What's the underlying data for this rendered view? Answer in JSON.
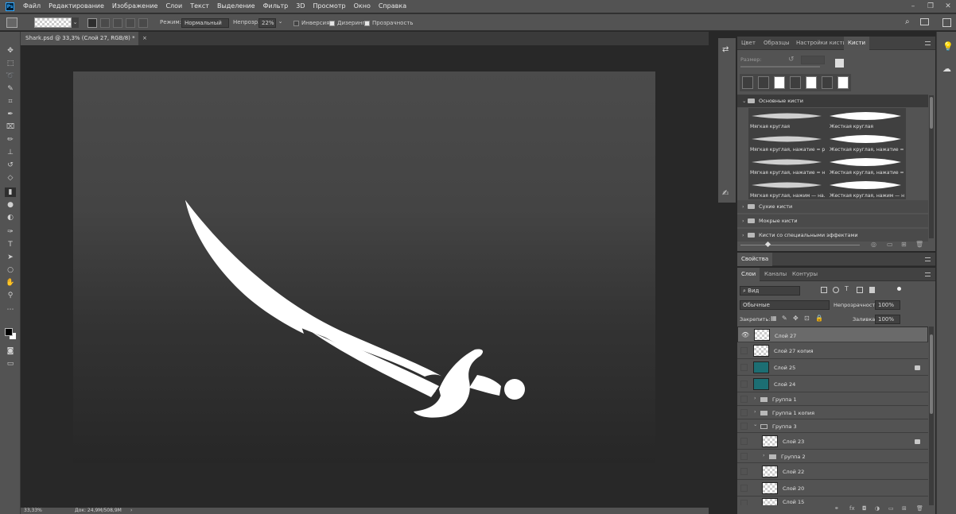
{
  "app": {
    "logo": "Ps"
  },
  "menu": [
    "Файл",
    "Редактирование",
    "Изображение",
    "Слои",
    "Текст",
    "Выделение",
    "Фильтр",
    "3D",
    "Просмотр",
    "Окно",
    "Справка"
  ],
  "options": {
    "mode_label": "Режим:",
    "mode_value": "Нормальный",
    "opacity_label": "Непрозр.:",
    "opacity_value": "22%",
    "inverse_label": "Инверсия",
    "dither_label": "Дизеринг",
    "transparency_label": "Прозрачность"
  },
  "document": {
    "tab_title": "Shark.psd @ 33,3% (Слой 27, RGB/8) *",
    "close": "×"
  },
  "status": {
    "zoom": "33,33%",
    "doc": "Док: 24,9M/508,9M",
    "arrow": "›"
  },
  "brush_panel": {
    "tabs": [
      "Цвет",
      "Образцы",
      "Настройки кисти",
      "Кисти"
    ],
    "size_label": "Размер:",
    "groups": {
      "basic": "Основные кисти",
      "dry": "Сухие кисти",
      "wet": "Мокрые кисти",
      "special": "Кисти со специальными эффектами"
    },
    "brushes": [
      "Мягкая круглая",
      "Жесткая круглая",
      "Мягкая круглая, нажатие = р...",
      "Жесткая круглая, нажатие =...",
      "Мягкая круглая, нажатие = н...",
      "Жесткая круглая, нажатие =...",
      "Мягкая круглая, нажим — на...",
      "Жесткая круглая, нажим — н..."
    ]
  },
  "properties_panel": {
    "tab": "Свойства"
  },
  "layers_panel": {
    "tabs": [
      "Слои",
      "Каналы",
      "Контуры"
    ],
    "filter_label": "Вид",
    "blend_mode": "Обычные",
    "opacity_label": "Непрозрачность:",
    "opacity_value": "100%",
    "lock_label": "Закрепить:",
    "fill_label": "Заливка:",
    "fill_value": "100%",
    "layers": [
      {
        "name": "Слой 27",
        "type": "layer",
        "visible": true,
        "selected": true,
        "locked": false
      },
      {
        "name": "Слой 27 копия",
        "type": "layer",
        "visible": false,
        "selected": false,
        "locked": false
      },
      {
        "name": "Слой 25",
        "type": "layer",
        "visible": false,
        "selected": false,
        "locked": true
      },
      {
        "name": "Слой 24",
        "type": "layer",
        "visible": false,
        "selected": false,
        "locked": false
      },
      {
        "name": "Группа 1",
        "type": "group",
        "visible": false,
        "selected": false,
        "locked": false
      },
      {
        "name": "Группа 1 копия",
        "type": "group",
        "visible": false,
        "selected": false,
        "locked": false
      },
      {
        "name": "Группа 3",
        "type": "group-open",
        "visible": false,
        "selected": false,
        "locked": false
      },
      {
        "name": "Слой 23",
        "type": "layer",
        "visible": false,
        "selected": false,
        "locked": true
      },
      {
        "name": "Группа 2",
        "type": "group",
        "visible": false,
        "selected": false,
        "locked": false
      },
      {
        "name": "Слой 22",
        "type": "layer",
        "visible": false,
        "selected": false,
        "locked": false
      },
      {
        "name": "Слой 20",
        "type": "layer",
        "visible": false,
        "selected": false,
        "locked": false
      },
      {
        "name": "Слой 15",
        "type": "layer",
        "visible": false,
        "selected": false,
        "locked": false
      }
    ]
  },
  "colors": {
    "ui_dark": "#535353",
    "canvas_bg": "#282828",
    "selected_layer": "#6a6a6a",
    "foreground": "#000000",
    "background": "#ffffff",
    "accent": "#31a8ff"
  }
}
